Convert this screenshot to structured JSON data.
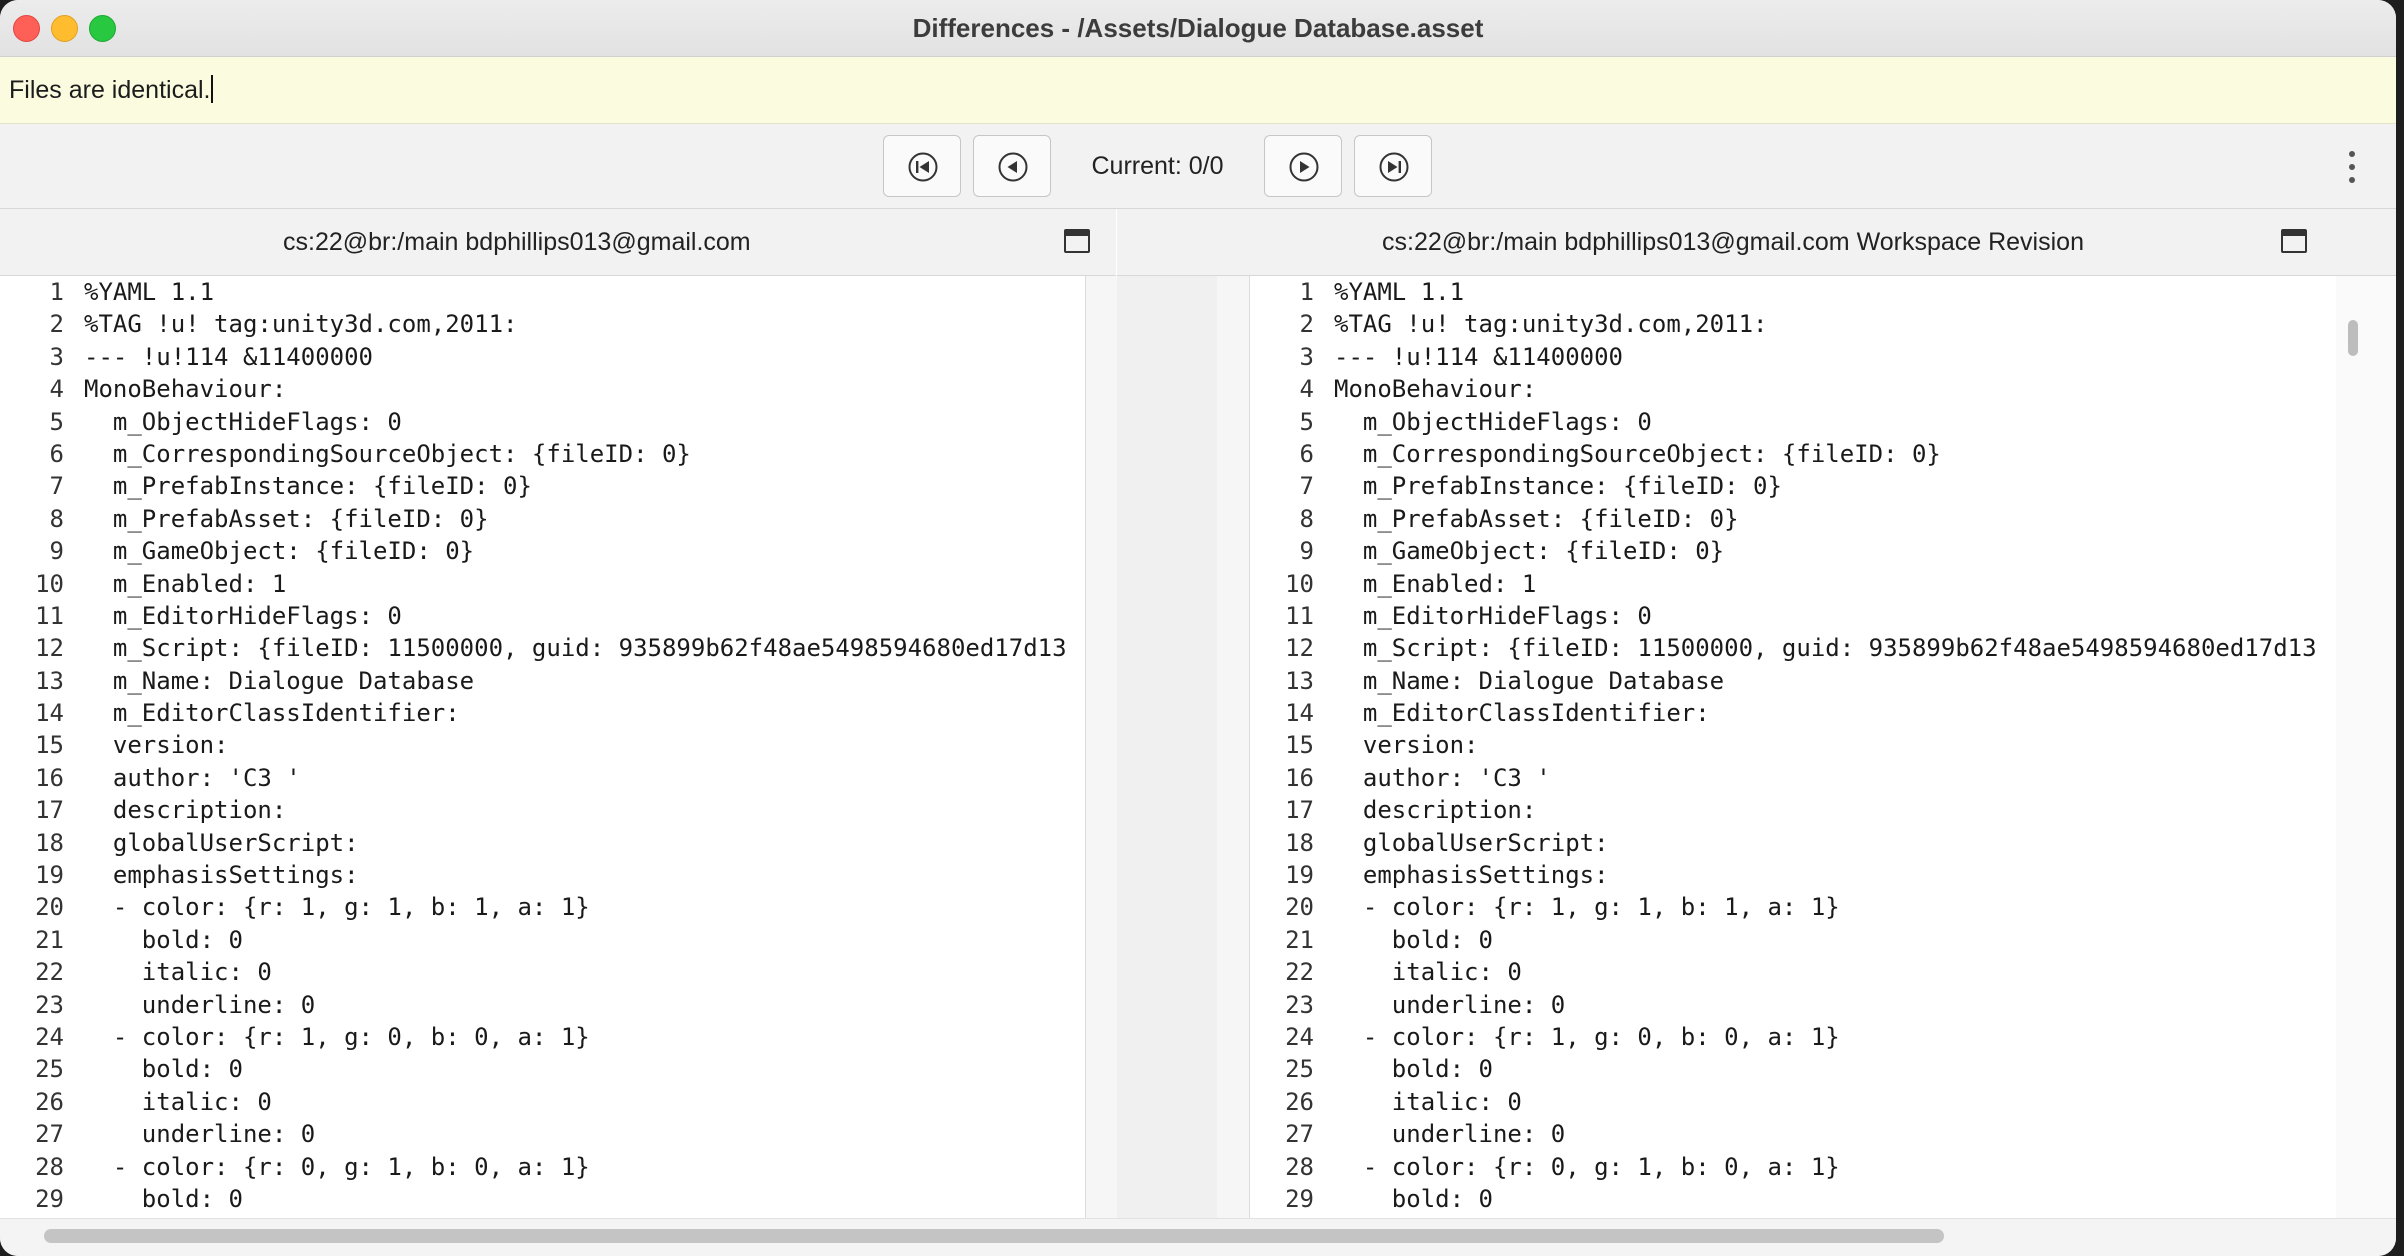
{
  "window": {
    "title": "Differences - /Assets/Dialogue Database.asset"
  },
  "status": {
    "message": "Files are identical."
  },
  "toolbar": {
    "current": "Current: 0/0"
  },
  "panes": {
    "left": {
      "header": "cs:22@br:/main bdphillips013@gmail.com"
    },
    "right": {
      "header": "cs:22@br:/main bdphillips013@gmail.com Workspace Revision"
    }
  },
  "icons": [
    "first-diff-icon",
    "previous-diff-icon",
    "next-diff-icon",
    "last-diff-icon",
    "more-options-icon",
    "maximize-pane-icon"
  ],
  "lines": [
    {
      "n": "1",
      "t": "%YAML 1.1"
    },
    {
      "n": "2",
      "t": "%TAG !u! tag:unity3d.com,2011:"
    },
    {
      "n": "3",
      "t": "--- !u!114 &11400000"
    },
    {
      "n": "4",
      "t": "MonoBehaviour:"
    },
    {
      "n": "5",
      "t": "  m_ObjectHideFlags: 0"
    },
    {
      "n": "6",
      "t": "  m_CorrespondingSourceObject: {fileID: 0}"
    },
    {
      "n": "7",
      "t": "  m_PrefabInstance: {fileID: 0}"
    },
    {
      "n": "8",
      "t": "  m_PrefabAsset: {fileID: 0}"
    },
    {
      "n": "9",
      "t": "  m_GameObject: {fileID: 0}"
    },
    {
      "n": "10",
      "t": "  m_Enabled: 1"
    },
    {
      "n": "11",
      "t": "  m_EditorHideFlags: 0"
    },
    {
      "n": "12",
      "t": "  m_Script: {fileID: 11500000, guid: 935899b62f48ae5498594680ed17d13"
    },
    {
      "n": "13",
      "t": "  m_Name: Dialogue Database"
    },
    {
      "n": "14",
      "t": "  m_EditorClassIdentifier:"
    },
    {
      "n": "15",
      "t": "  version:"
    },
    {
      "n": "16",
      "t": "  author: 'C3 '"
    },
    {
      "n": "17",
      "t": "  description:"
    },
    {
      "n": "18",
      "t": "  globalUserScript:"
    },
    {
      "n": "19",
      "t": "  emphasisSettings:"
    },
    {
      "n": "20",
      "t": "  - color: {r: 1, g: 1, b: 1, a: 1}"
    },
    {
      "n": "21",
      "t": "    bold: 0"
    },
    {
      "n": "22",
      "t": "    italic: 0"
    },
    {
      "n": "23",
      "t": "    underline: 0"
    },
    {
      "n": "24",
      "t": "  - color: {r: 1, g: 0, b: 0, a: 1}"
    },
    {
      "n": "25",
      "t": "    bold: 0"
    },
    {
      "n": "26",
      "t": "    italic: 0"
    },
    {
      "n": "27",
      "t": "    underline: 0"
    },
    {
      "n": "28",
      "t": "  - color: {r: 0, g: 1, b: 0, a: 1}"
    },
    {
      "n": "29",
      "t": "    bold: 0"
    }
  ]
}
